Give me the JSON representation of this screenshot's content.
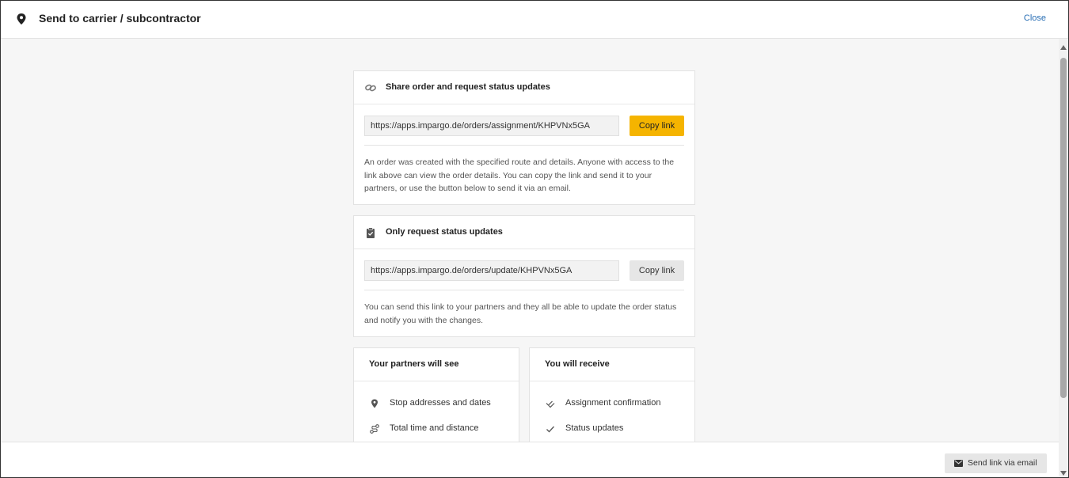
{
  "header": {
    "title": "Send to carrier / subcontractor",
    "close_label": "Close"
  },
  "share_card": {
    "title": "Share order and request status updates",
    "link": "https://apps.impargo.de/orders/assignment/KHPVNx5GA",
    "copy_label": "Copy link",
    "description": "An order was created with the specified route and details. Anyone with access to the link above can view the order details. You can copy the link and send it to your partners, or use the button below to send it via an email."
  },
  "status_card": {
    "title": "Only request status updates",
    "link": "https://apps.impargo.de/orders/update/KHPVNx5GA",
    "copy_label": "Copy link",
    "description": "You can send this link to your partners and they all be able to update the order status and notify you with the changes."
  },
  "partners_card": {
    "title": "Your partners will see",
    "items": [
      "Stop addresses and dates",
      "Total time and distance"
    ]
  },
  "receive_card": {
    "title": "You will receive",
    "items": [
      "Assignment confirmation",
      "Status updates"
    ]
  },
  "footer": {
    "send_label": "Send link via email"
  },
  "colors": {
    "accent": "#f5b400",
    "link": "#2a6fb5"
  }
}
